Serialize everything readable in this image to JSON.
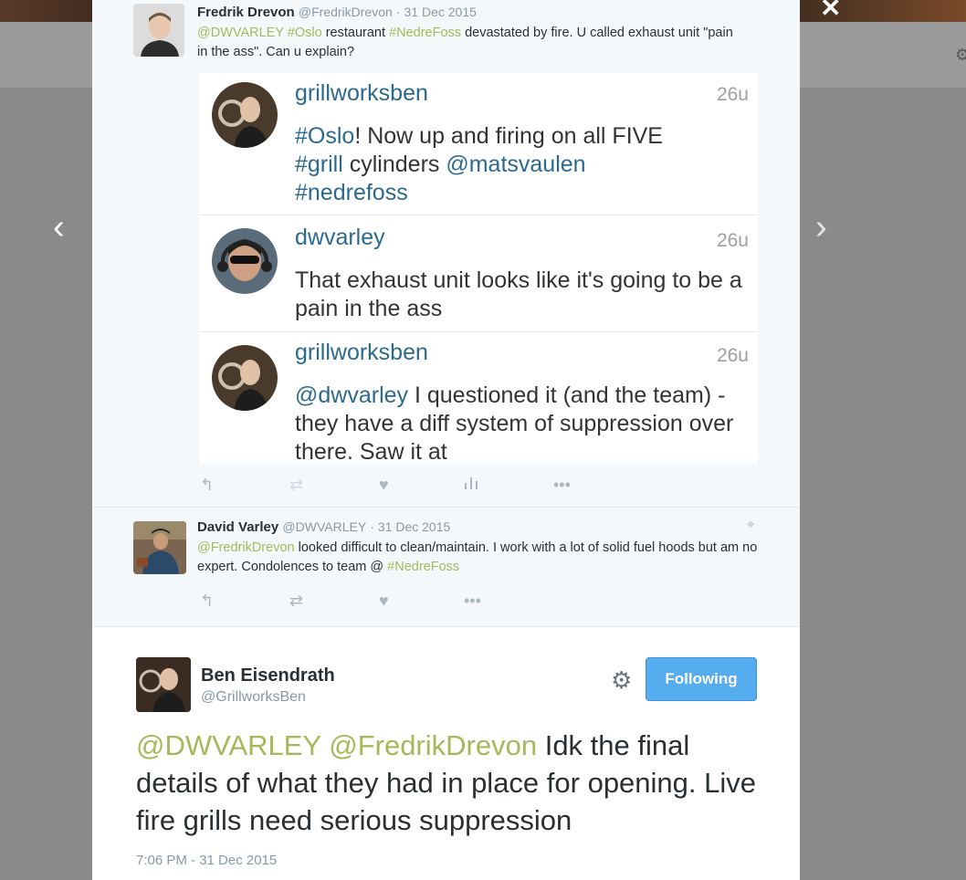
{
  "icons": {
    "prev": "chevron-left-icon",
    "next": "chevron-right-icon",
    "close": "close-icon",
    "reply": "reply-icon",
    "retweet": "retweet-icon",
    "like": "heart-icon",
    "analytics": "analytics-icon",
    "more": "more-icon",
    "location": "location-pin-icon",
    "settings": "gear-icon"
  },
  "tweet1": {
    "name": "Fredrik Drevon",
    "handle": "@FredrikDrevon",
    "date": "31 Dec 2015",
    "mentions": "@DWVARLEY",
    "tag_oslo": "#Oslo",
    "text_a": "restaurant",
    "tag_nedrefoss": "#NedreFoss",
    "text_b": "devastated by fire. U called exhaust unit \"pain in the ass\". Can u explain?"
  },
  "embedded": {
    "messages": [
      {
        "user": "grillworksben",
        "time": "26u",
        "tag1": "#Oslo",
        "text1": "! Now up and firing on all FIVE",
        "tag2": "#grill",
        "text2": " cylinders ",
        "tag3": "@matsvaulen",
        "tag4": "#nedrefoss"
      },
      {
        "user": "dwvarley",
        "time": "26u",
        "text": "That exhaust unit looks like it's going to be a pain in the ass"
      },
      {
        "user": "grillworksben",
        "time": "26u",
        "tag1": "@dwvarley",
        "text1": " I questioned it (and the team) - they have a diff system of suppression over there. Saw it at"
      }
    ]
  },
  "tweet2": {
    "name": "David Varley",
    "handle": "@DWVARLEY",
    "date": "31 Dec 2015",
    "mention": "@FredrikDrevon",
    "text_a": "looked difficult to clean/maintain. I work with a lot of solid fuel hoods but am no expert. Condolences to team @",
    "tag": "#NedreFoss"
  },
  "main_tweet": {
    "name": "Ben Eisendrath",
    "handle": "@GrillworksBen",
    "follow_label": "Following",
    "mention1": "@DWVARLEY",
    "mention2": "@FredrikDrevon",
    "text": "Idk the final details of what they had in place for opening. Live fire grills need serious suppression",
    "timestamp": "7:06 PM - 31 Dec 2015"
  },
  "colors": {
    "accent_blue": "#55acee",
    "hashtag_green": "#a7b85a",
    "username_blue": "#2b6a8e"
  }
}
